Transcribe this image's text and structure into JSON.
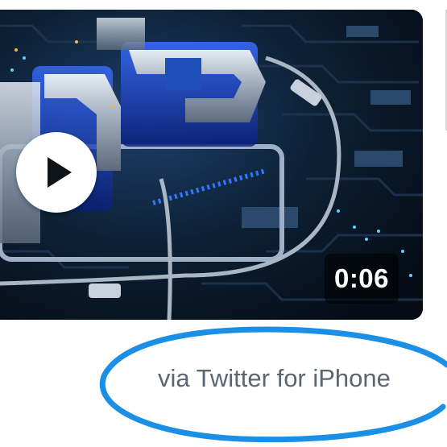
{
  "video": {
    "duration": "0:06",
    "play_icon": "play-icon"
  },
  "tweet_meta": {
    "source": "via Twitter for iPhone"
  },
  "annotation": {
    "highlight_color": "#1b8fe6"
  }
}
